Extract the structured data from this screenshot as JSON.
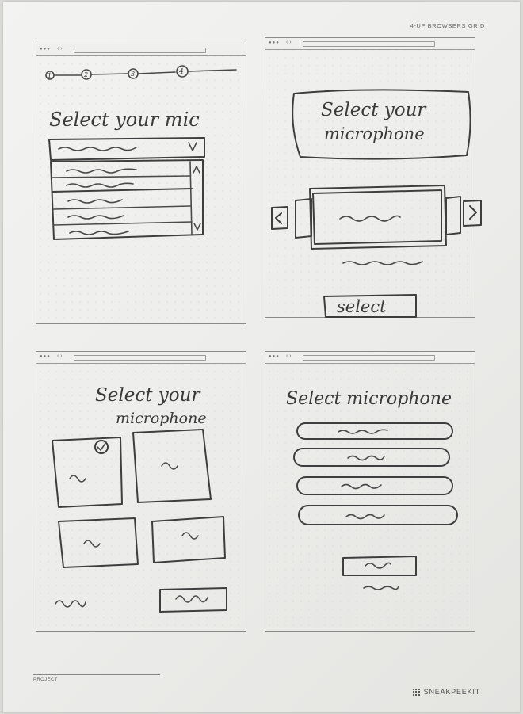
{
  "sheet": {
    "header_label": "4-UP BROWSERS GRID",
    "footer_label": "PROJECT",
    "brand": "SNEAKPEEKIT"
  },
  "frames": [
    {
      "title": "Select your mic",
      "steps": [
        "1",
        "2",
        "3",
        "4"
      ],
      "dropdown_icon": "chevron-down-icon",
      "scroll_up_icon": "scroll-up-icon",
      "scroll_down_icon": "scroll-down-icon"
    },
    {
      "title_line1": "Select your",
      "title_line2": "microphone",
      "button_label": "select",
      "prev_icon": "chevron-left-icon",
      "next_icon": "chevron-right-icon"
    },
    {
      "title_line1": "Select your",
      "title_line2": "microphone",
      "selected_icon": "check-circle-icon"
    },
    {
      "title": "Select microphone"
    }
  ]
}
